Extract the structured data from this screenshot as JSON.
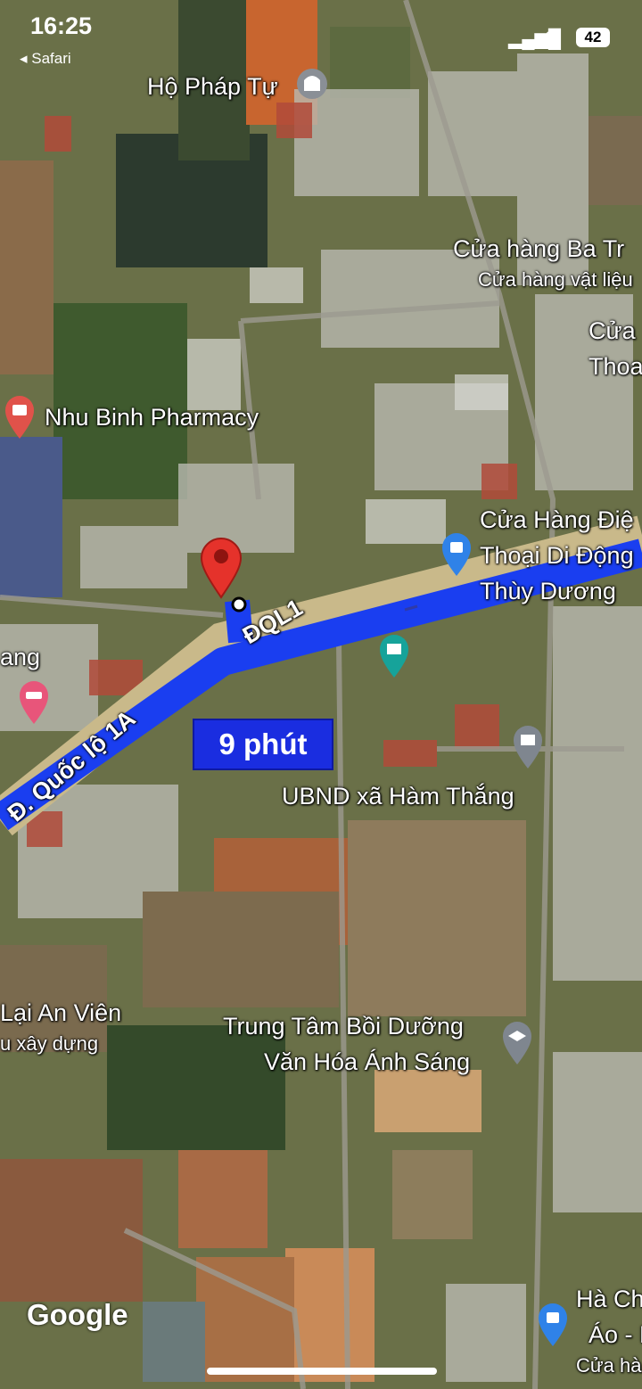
{
  "status_bar": {
    "time": "16:25",
    "back_app": "◂ Safari",
    "battery": "42"
  },
  "route": {
    "duration": "9 phút",
    "road_label": "ĐQL1",
    "road_label_2": "Đ. Quốc lộ 1A",
    "route_color": "#1a3ef0"
  },
  "places": {
    "temple": "Hộ Pháp Tự",
    "store1_line1": "Cửa hàng Ba Tr",
    "store1_line2": "Cửa hàng vật liệu",
    "store2_line1": "Cửa",
    "store2_line2": "Thoa",
    "pharmacy": "Nhu Binh Pharmacy",
    "phone_line1": "Cửa Hàng Điệ",
    "phone_line2": "Thoại Di Động",
    "phone_line3": "Thùy Dương",
    "left_partial": "ang",
    "commune": "UBND xã Hàm Thắng",
    "lai_line1": "Lại An Viên",
    "lai_line2": "u xây dựng",
    "center_line1": "Trung Tâm Bồi Dưỡng",
    "center_line2": "Văn Hóa Ánh Sáng",
    "ha_line1": "Hà Ch",
    "ha_line2": "Áo - N",
    "ha_line3": "Cửa hà"
  },
  "branding": {
    "logo": "Google"
  },
  "icons": [
    "temple-icon",
    "pharmacy-icon",
    "shopping-bag-icon",
    "museum-icon",
    "hotel-icon",
    "government-icon",
    "school-icon",
    "destination-pin-icon",
    "origin-dot-icon"
  ]
}
